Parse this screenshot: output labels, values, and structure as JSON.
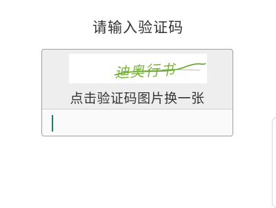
{
  "dialog": {
    "title": "请输入验证码",
    "captcha": {
      "text": "迪奥行书",
      "text_color": "#7ab33c",
      "strike_color": "#5f9e2a",
      "hint": "点击验证码图片换一张"
    },
    "input": {
      "value": "",
      "placeholder": "",
      "caret_color": "#1a7f6e"
    }
  }
}
